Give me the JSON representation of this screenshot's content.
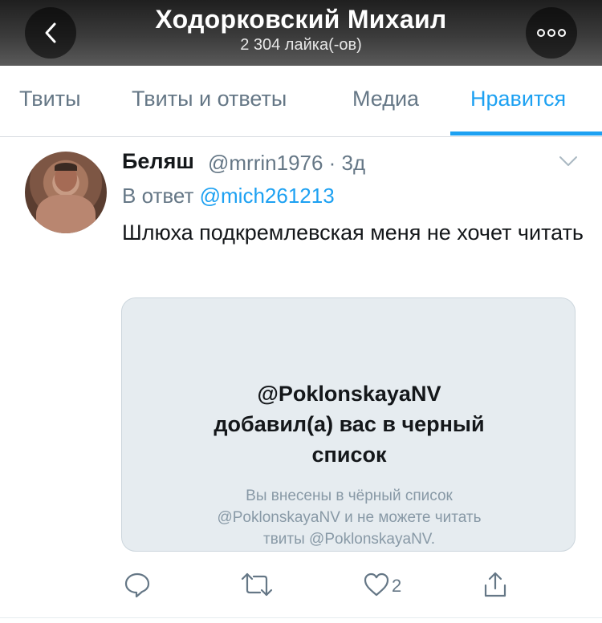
{
  "header": {
    "title": "Ходорковский Михаил",
    "subtitle": "2 304 лайка(-ов)"
  },
  "tabs": [
    {
      "label": "Твиты",
      "active": false
    },
    {
      "label": "Твиты и ответы",
      "active": false
    },
    {
      "label": "Медиа",
      "active": false
    },
    {
      "label": "Нравится",
      "active": true
    }
  ],
  "tweet": {
    "author_name": "Беляш",
    "author_meta": "@mrrin1976 · 3д",
    "reply_prefix": "В ответ",
    "reply_handle": "@mich261213",
    "text": "Шлюха подкремлевская меня не хочет читать",
    "card": {
      "title_line1": "@PoklonskayaNV",
      "title_line2": "добавил(а) вас в черный",
      "title_line3": "список",
      "body_line1": "Вы внесены в чёрный список",
      "body_line2": "@PoklonskayaNV и не можете читать",
      "body_line3": "твиты @PoklonskayaNV."
    },
    "actions": {
      "reply_icon": "reply-icon",
      "retweet_icon": "retweet-icon",
      "like_icon": "heart-icon",
      "like_count": "2",
      "share_icon": "share-icon"
    }
  },
  "colors": {
    "accent": "#1da1f2",
    "secondary_text": "#657786",
    "card_bg": "#e6ecf0"
  }
}
